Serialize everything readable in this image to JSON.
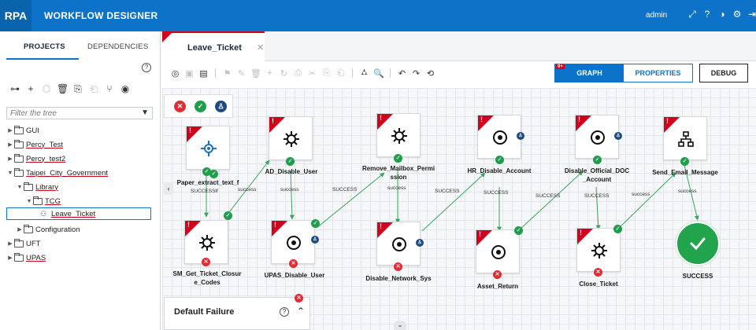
{
  "header": {
    "logo": "RPA",
    "title": "WORKFLOW DESIGNER",
    "user": "admin",
    "icons": [
      "expand-icon",
      "help-icon",
      "theme-icon",
      "settings-icon",
      "logout-icon"
    ]
  },
  "left": {
    "tabs": [
      "PROJECTS",
      "DEPENDENCIES"
    ],
    "filter_placeholder": "Filter the tree",
    "tree": [
      {
        "label": "GUI"
      },
      {
        "label": "Percy_Test"
      },
      {
        "label": "Percy_test2"
      },
      {
        "label": "Taipei_City_Government"
      },
      {
        "label": "Library"
      },
      {
        "label": "TCG"
      },
      {
        "label": "Leave_Ticket"
      },
      {
        "label": "Configuration"
      },
      {
        "label": "UFT"
      },
      {
        "label": "UPAS"
      }
    ]
  },
  "main": {
    "tab_title": "Leave_Ticket",
    "view_toggle": {
      "graph": "GRAPH",
      "properties": "PROPERTIES",
      "badge": "9+"
    },
    "debug": "DEBUG",
    "failure_title": "Default Failure",
    "nodes": {
      "n1": "Paper_extract_text_f",
      "n2": "AD_Disable_User",
      "n3": "Remove_Mailbox_Permi ssion",
      "n4": "HR_Disable_Account",
      "n5": "Disable_Official_DOC _Account",
      "n6": "Send_Email_Message",
      "n7": "SM_Get_Ticket_Closur e_Codes",
      "n8": "UPAS_Disable_User",
      "n9": "Disable_Network_Sys",
      "n10": "Asset_Return",
      "n11": "Close_Ticket",
      "success": "SUCCESS"
    },
    "edges": {
      "success": "SUCCESS",
      "success_small": "success",
      "successlf": "SUCCESSlf"
    }
  }
}
